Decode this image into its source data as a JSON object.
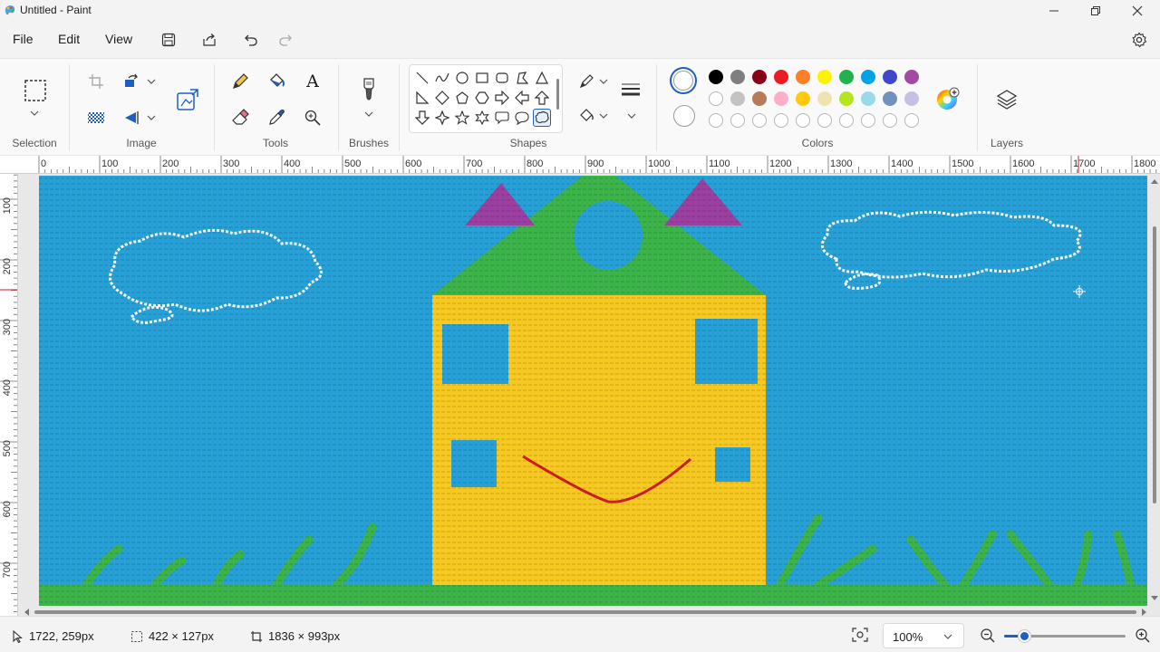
{
  "window": {
    "title": "Untitled - Paint"
  },
  "menu": {
    "file": "File",
    "edit": "Edit",
    "view": "View"
  },
  "ribbon": {
    "groups": {
      "selection": "Selection",
      "image": "Image",
      "tools": "Tools",
      "brushes": "Brushes",
      "shapes": "Shapes",
      "colors": "Colors",
      "layers": "Layers"
    },
    "tools": {
      "text_glyph": "A"
    }
  },
  "colors": {
    "primary": "#ffffff",
    "secondary": "#ffffff",
    "palette_row1": [
      "#000000",
      "#7f7f7f",
      "#880015",
      "#ed1c24",
      "#ff7f27",
      "#fff200",
      "#22b14c",
      "#00a2e8",
      "#3f48cc",
      "#a349a4"
    ],
    "palette_row2": [
      "#ffffff",
      "#c3c3c3",
      "#b97a57",
      "#ffaec9",
      "#ffc90e",
      "#efe4b0",
      "#b5e61d",
      "#99d9ea",
      "#7092be",
      "#c8bfe7"
    ],
    "custom_slots": 10
  },
  "ruler": {
    "h_labels": [
      "0",
      "100",
      "200",
      "300",
      "400",
      "500",
      "600",
      "700",
      "800",
      "900",
      "1000",
      "1100",
      "1200",
      "1300",
      "1400",
      "1500",
      "1600",
      "1700",
      "1800"
    ],
    "v_labels": [
      "100",
      "200",
      "300",
      "400",
      "500",
      "600",
      "700"
    ]
  },
  "canvas_colors": {
    "sky": "#26a0d6",
    "wall": "#f7c821",
    "roof": "#3cb44a",
    "ears": "#9b3fa0",
    "smile": "#d01c25",
    "ground": "#3cb44a",
    "cloud": "#ffffff"
  },
  "status": {
    "cursor_pos": "1722, 259px",
    "selection_size": "422 × 127px",
    "canvas_size": "1836 × 993px",
    "zoom": "100%"
  }
}
